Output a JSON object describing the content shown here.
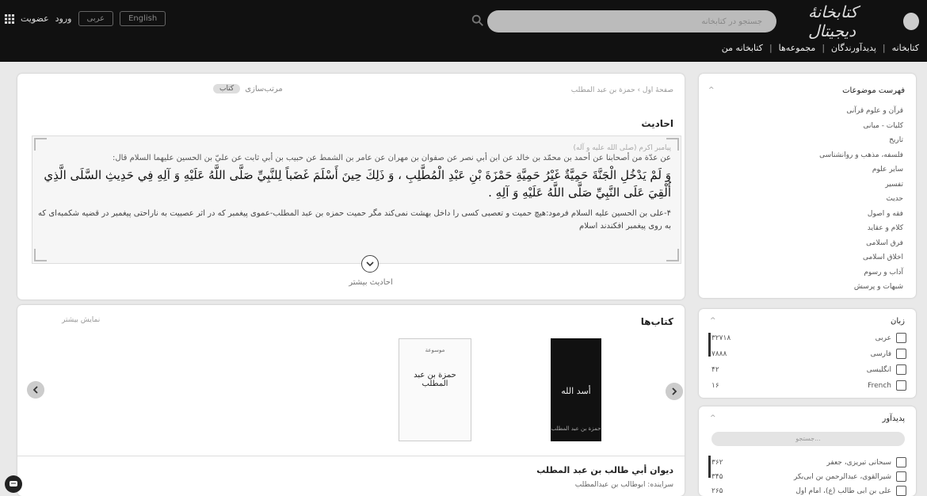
{
  "header": {
    "brand": "کتابخانهٔ دیجیتال",
    "search_placeholder": "جستجو در کتابخانه",
    "language_buttons": [
      "English",
      "عربی"
    ],
    "login_label": "ورود",
    "signup_label": "عضویت"
  },
  "nav": {
    "items": [
      "کتابخانه",
      "پدیدآورندگان",
      "مجموعه‌ها",
      "کتابخانه من"
    ]
  },
  "main": {
    "breadcrumb": "صفحهٔ اول › حمزة بن عبد المطلب",
    "section_title": "احادیث",
    "sort_label": "مرتب‌سازی",
    "sort_value": "کتاب",
    "hadith": {
      "speaker": "پیامبر اکرم (صلی الله علیه و آله)",
      "chain": "عن عدّة من أصحابنا عن أحمد بن محمّد بن خالد عن ابن أبي نصر عن صفوان بن مهران عن عامر بن الشمط عن حبيب بن أبي ثابت عن عليّ بن الحسين عليهما السلام قال:",
      "arabic": "وَ لَمْ يَدْخُلِ الْجَنَّةَ حَمِيَّةٌ غَيْرُ حَمِيَّةِ حَمْزَةَ بْنِ عَبْدِ الْمُطَّلِبِ ، وَ ذَلِكَ حِينَ أَسْلَمَ غَضَباً لِلنَّبِيِّ صَلَّى اللَّهُ عَلَيْهِ وَ آلِهِ فِي حَدِيثِ السَّلَى الَّذِي أُلْقِيَ عَلَى النَّبِيِّ صَلَّى اللَّهُ عَلَيْهِ وَ آلِهِ .",
      "persian": "۴-علی بن الحسین علیه السلام فرمود:هیچ حمیت و تعصبی کسی را داخل بهشت نمی‌کند مگر حمیت حمزه بن عبد المطلب-عموی پیغمبر که در اثر عصبیت به ناراحتی پیغمبر در قضیه شکمبه‌ای که به روی پیغمبر افکندند اسلام"
    },
    "more_label": "احادیث بیشتر"
  },
  "books": {
    "title": "کتاب‌ها",
    "show_more": "نمایش بیشتر",
    "items": [
      {
        "cover_title": "أسد الله",
        "cover_subtitle": "حمزة بن عبد المطلب"
      },
      {
        "cover_title": "حمزة بن عبد المطلب",
        "cover_subtitle": "موسوعة"
      }
    ],
    "featured_title": "دیوان أبي طالب بن عبد المطلب",
    "featured_author": "سراینده: ابوطالب بن عبدالمطلب"
  },
  "sidebar": {
    "topics_title": "فهرست موضوعات",
    "topics": [
      "قرآن و علوم قرآنی",
      "کلیات - مبانی",
      "تاریخ",
      "فلسفه، مذهب و روانشناسی",
      "سایر علوم",
      "تفسیر",
      "حدیث",
      "فقه و اصول",
      "کلام و عقاید",
      "فرق اسلامی",
      "اخلاق اسلامی",
      "آداب و رسوم",
      "شبهات و پرسش"
    ],
    "language_title": "زبان",
    "languages": [
      {
        "label": "عربی",
        "count": "۳۲۷۱۸"
      },
      {
        "label": "فارسی",
        "count": "۷۸۸۸"
      },
      {
        "label": "انگلیسی",
        "count": "۴۲"
      },
      {
        "label": "French",
        "count": "۱۶"
      }
    ],
    "author_title": "پدیدآور",
    "author_search_placeholder": "جستجو...",
    "authors": [
      {
        "label": "سبحانی تبریزی، جعفر",
        "count": "۳۶۲"
      },
      {
        "label": "شیرالقوی، عبدالرحمن بن ابی‌بکر",
        "count": "۳۴۵"
      },
      {
        "label": "علی بن ابی طالب (ع)، امام اول",
        "count": "۲۶۵"
      }
    ]
  },
  "colors": {
    "topbar": "#111111",
    "panel_bg": "#ffffff",
    "page_bg": "#e9e9e9"
  }
}
